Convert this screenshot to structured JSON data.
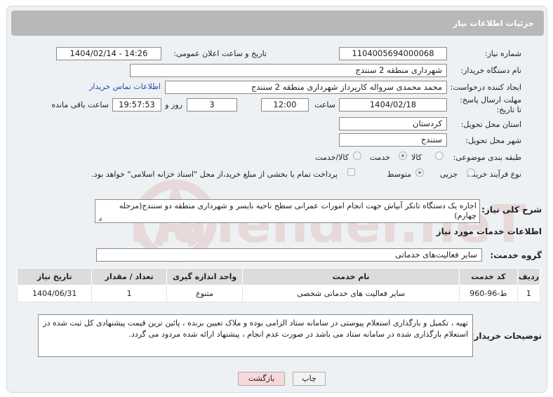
{
  "header": {
    "title": "جزئیات اطلاعات نیاز"
  },
  "fields": {
    "need_number_label": "شماره نیاز:",
    "need_number": "1104005694000068",
    "announce_label": "تاریخ و ساعت اعلان عمومی:",
    "announce_value": "1404/02/14 - 14:26",
    "buyer_org_label": "نام دستگاه خریدار:",
    "buyer_org": "شهرداری منطقه 2 سنندج",
    "creator_label": "ایجاد کننده درخواست:",
    "creator": "محمد محمدی سرواله کارپرداز شهرداری منطقه 2 سنندج",
    "buyer_contact_link": "اطلاعات تماس خریدار",
    "deadline_label": "مهلت ارسال پاسخ: تا تاریخ:",
    "deadline_date": "1404/02/18",
    "time_label": "ساعت",
    "deadline_time": "12:00",
    "days_value": "3",
    "days_label": "روز و",
    "remaining_time": "19:57:53",
    "remaining_label": "ساعت باقی مانده",
    "province_label": "استان محل تحویل:",
    "province": "کردستان",
    "city_label": "شهر محل تحویل:",
    "city": "سنندج",
    "category_label": "طبقه بندی موضوعی:",
    "category_options": [
      "کالا",
      "خدمت",
      "کالا/خدمت"
    ],
    "category_selected": "خدمت",
    "process_label": "نوع فرآیند خرید :",
    "process_options": [
      "جزیی",
      "متوسط"
    ],
    "process_selected": "متوسط",
    "payment_note": "پرداخت تمام یا بخشی از مبلغ خرید،از محل \"اسناد خزانه اسلامی\" خواهد بود."
  },
  "description": {
    "label": "شرح کلی نیاز:",
    "text": "اجاره یک دستگاه تانکر آبپاش جهت انجام امورات عمرانی سطح ناحیه نایسر و شهرداری منطقه دو سنندج(مرحله چهارم)"
  },
  "services": {
    "section_title": "اطلاعات خدمات مورد نیاز",
    "group_label": "گروه خدمت:",
    "group_value": "سایر فعالیت‌های خدماتی",
    "columns": [
      "ردیف",
      "کد خدمت",
      "نام خدمت",
      "واحد اندازه گیری",
      "تعداد / مقدار",
      "تاریخ نیاز"
    ],
    "rows": [
      [
        "1",
        "ط-96-960",
        "سایر فعالیت های خدماتی شخصی",
        "متنوع",
        "1",
        "1404/06/31"
      ]
    ]
  },
  "buyer_notes": {
    "label": "توضیحات خریدار:",
    "text": "تهیه  ،  تکمیل و بارگذاری استعلام پیوستی در سامانه ستاد الزامی بوده و ملاک تعیین برنده ، پائین ترین قیمت پیشنهادی کل ثبت شده در استعلام بارگذاری شده در سامانه ستاد می باشد در صورت عدم انجام ، پیشنهاد ارائه شده مردود می گردد."
  },
  "buttons": {
    "print": "چاپ",
    "back": "بازگشت"
  },
  "watermark": {
    "text": "AriaTender.neT"
  },
  "colors": {
    "header_bg": "#b8b8b8",
    "panel_bg": "#eef1f4",
    "link": "#1f4ea8",
    "back_button_bg": "#f7d9dc",
    "watermark": "#c0392b"
  }
}
